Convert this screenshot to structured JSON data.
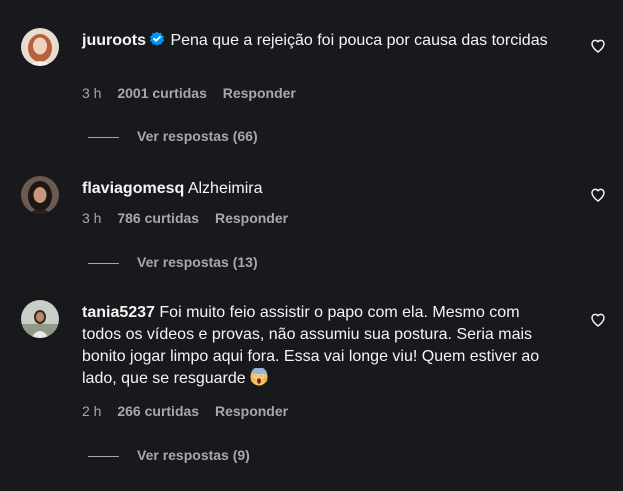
{
  "comments": [
    {
      "username": "juuroots",
      "verified": true,
      "text": "Pena que a rejeição foi pouca por causa das torcidas",
      "time": "3 h",
      "likes": "2001 curtidas",
      "reply_label": "Responder",
      "view_replies": "Ver respostas (66)"
    },
    {
      "username": "flaviagomesq",
      "verified": false,
      "text": "Alzheimira",
      "time": "3 h",
      "likes": "786 curtidas",
      "reply_label": "Responder",
      "view_replies": "Ver respostas (13)"
    },
    {
      "username": "tania5237",
      "verified": false,
      "text": "Foi muito feio assistir o papo com ela. Mesmo com todos os vídeos e provas, não assumiu sua postura. Seria mais bonito jogar limpo aqui fora. Essa vai longe viu! Quem estiver ao lado, que se resguarde",
      "emoji": "😱",
      "time": "2 h",
      "likes": "266 curtidas",
      "reply_label": "Responder",
      "view_replies": "Ver respostas (9)"
    }
  ],
  "colors": {
    "background": "#18191c",
    "text": "#f5f5f5",
    "secondary": "#a8a8a8",
    "verified": "#0095f6"
  },
  "icons": {
    "verified": "verified-badge-icon",
    "like": "heart-icon"
  }
}
